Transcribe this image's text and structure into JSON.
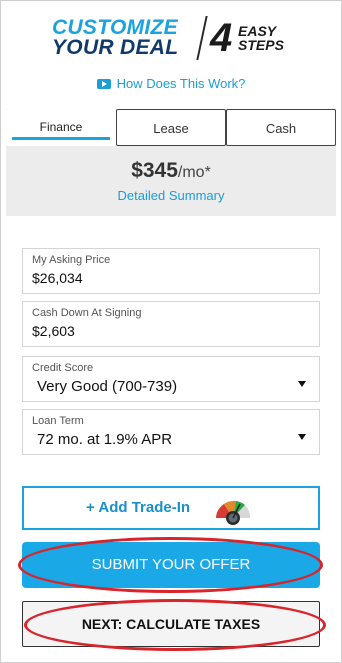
{
  "header": {
    "title_line1": "CUSTOMIZE",
    "title_line2": "YOUR DEAL",
    "steps_number": "4",
    "steps_word1": "EASY",
    "steps_word2": "STEPS",
    "how_link": "How Does This Work?"
  },
  "tabs": [
    {
      "label": "Finance",
      "active": true
    },
    {
      "label": "Lease",
      "active": false
    },
    {
      "label": "Cash",
      "active": false
    }
  ],
  "payment": {
    "amount": "$345",
    "period": "/mo*",
    "summary_link": "Detailed Summary"
  },
  "fields": [
    {
      "label": "My Asking Price",
      "value": "$26,034"
    },
    {
      "label": "Cash Down At Signing",
      "value": "$2,603"
    },
    {
      "label": "Credit Score",
      "value": "Very Good (700-739)"
    },
    {
      "label": "Loan Term",
      "value": "72 mo. at 1.9% APR"
    }
  ],
  "trade_in": {
    "label": "+ Add Trade-In"
  },
  "actions": {
    "submit_label": "SUBMIT YOUR OFFER",
    "next_label": "NEXT: CALCULATE TAXES"
  },
  "colors": {
    "accent": "#1aa3dd",
    "navy": "#103a6b",
    "highlight_ring": "#d8242b"
  },
  "icons": {
    "how_link": "play-icon",
    "dropdown": "chevron-down-icon",
    "trade_in": "gauge-icon"
  }
}
